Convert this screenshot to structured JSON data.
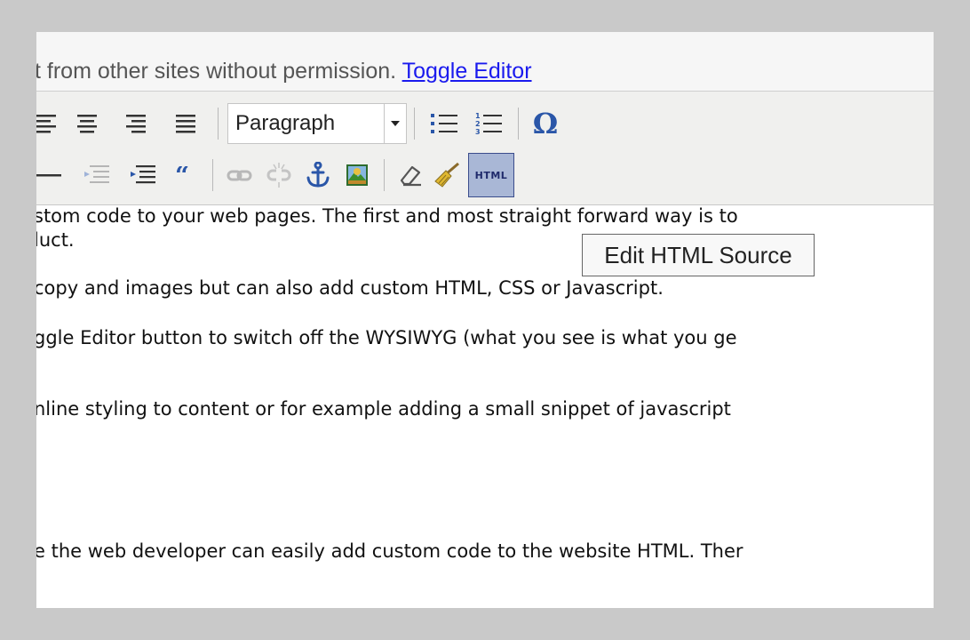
{
  "notice": {
    "text": "t from other sites without permission. ",
    "link": "Toggle Editor"
  },
  "toolbar": {
    "row1": {
      "align_icons": [
        "align-left-icon",
        "align-center-icon",
        "align-right-icon",
        "align-justify-icon"
      ],
      "format_select": {
        "value": "Paragraph"
      },
      "list_icons": [
        "bullet-list-icon",
        "numbered-list-icon"
      ],
      "special_char": "Ω"
    },
    "row2": {
      "icons": [
        "horizontal-rule-icon",
        "outdent-icon",
        "indent-icon",
        "blockquote-icon",
        "link-icon",
        "unlink-icon",
        "anchor-icon",
        "image-icon",
        "eraser-icon",
        "cleanup-icon"
      ],
      "html_button": "HTML"
    }
  },
  "tooltip": {
    "text": "Edit HTML Source"
  },
  "content": {
    "lines": [
      "stom code to your web pages. The first and most straight forward way is to",
      "luct.",
      "copy and images but can also add custom HTML, CSS or Javascript.",
      "ggle Editor button to switch off the WYSIWYG (what you see is what you ge",
      "nline styling to content or for example adding a small snippet of javascript",
      "e the web developer can easily add custom code to the website HTML. Ther"
    ]
  },
  "colors": {
    "background": "#c9c9c9",
    "toolbar": "#f0f0ee",
    "link": "#1a1aee",
    "html_button_bg": "#a9b7d6",
    "omega": "#2a56a8"
  }
}
